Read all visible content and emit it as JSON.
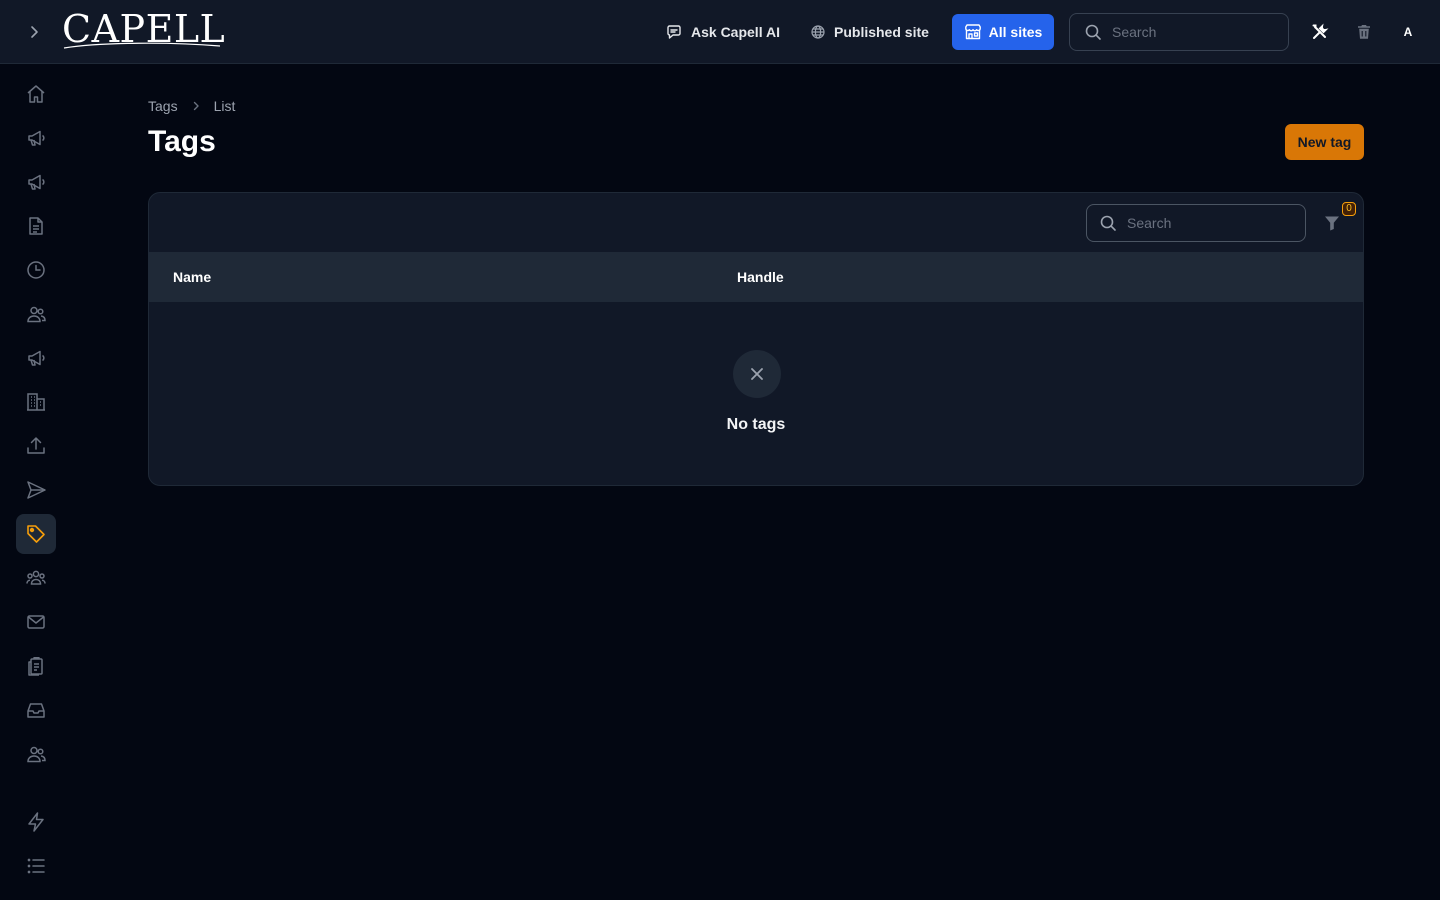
{
  "header": {
    "logo": "CAPELL",
    "ask_ai_label": "Ask Capell AI",
    "published_label": "Published site",
    "all_sites_label": "All sites",
    "search_placeholder": "Search",
    "avatar_initial": "A"
  },
  "sidebar": {
    "items": [
      {
        "icon": "home-icon"
      },
      {
        "icon": "megaphone-icon"
      },
      {
        "icon": "megaphone-icon"
      },
      {
        "icon": "document-icon"
      },
      {
        "icon": "clock-icon"
      },
      {
        "icon": "users-icon"
      },
      {
        "icon": "megaphone-icon"
      },
      {
        "icon": "building-icon"
      },
      {
        "icon": "upload-icon"
      },
      {
        "icon": "send-icon"
      },
      {
        "icon": "tag-icon",
        "active": true
      },
      {
        "icon": "user-group-icon"
      },
      {
        "icon": "envelope-icon"
      },
      {
        "icon": "clipboard-icon"
      },
      {
        "icon": "inbox-icon"
      },
      {
        "icon": "users-icon"
      },
      {
        "icon": "bolt-icon"
      },
      {
        "icon": "list-icon"
      }
    ]
  },
  "breadcrumb": {
    "root": "Tags",
    "current": "List"
  },
  "page": {
    "title": "Tags",
    "new_button": "New tag"
  },
  "table": {
    "search_placeholder": "Search",
    "filter_count": "0",
    "columns": [
      "Name",
      "Handle"
    ],
    "empty_text": "No tags"
  },
  "colors": {
    "background": "#030712",
    "panel": "#111827",
    "accent_blue": "#2563eb",
    "accent_orange": "#d97706",
    "active_icon": "#f59e0b"
  }
}
